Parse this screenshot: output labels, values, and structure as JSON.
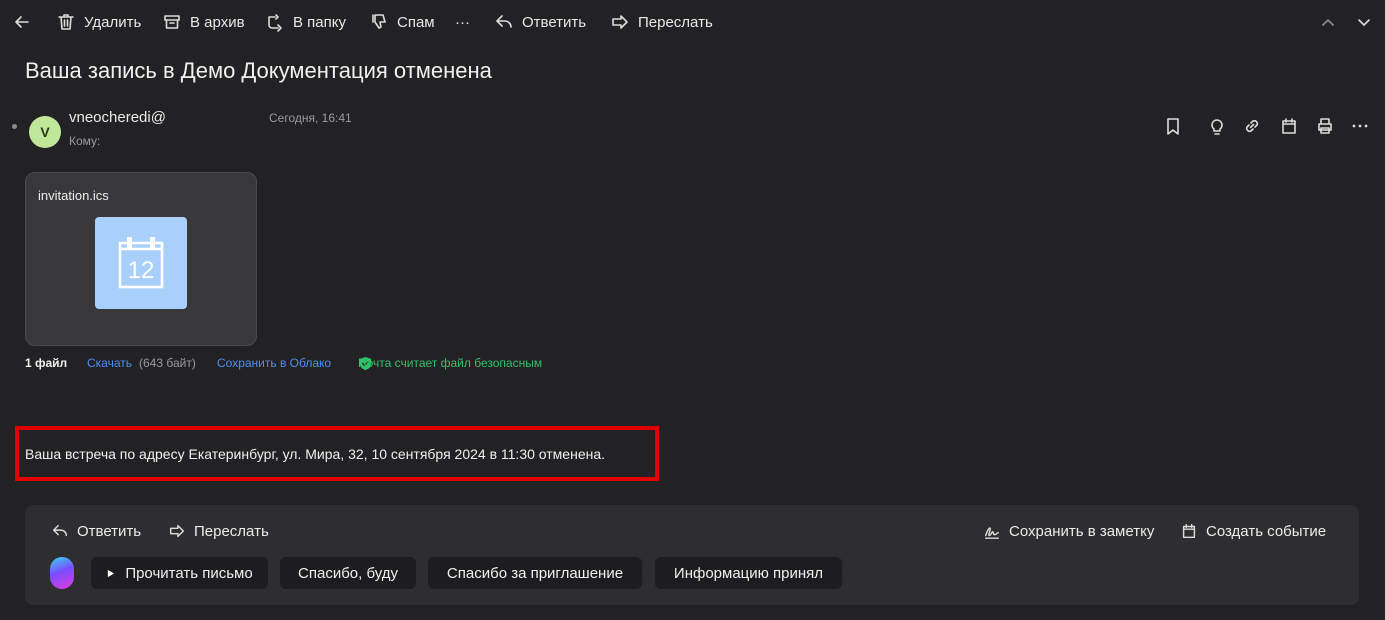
{
  "toolbar": {
    "back_icon": "arrow-left-icon",
    "delete_label": "Удалить",
    "archive_label": "В архив",
    "folder_label": "В папку",
    "spam_label": "Спам",
    "more_label": "···",
    "reply_label": "Ответить",
    "forward_label": "Переслать"
  },
  "subject": "Ваша запись в Демо Документация отменена",
  "message": {
    "avatar_letter": "V",
    "avatar_color": "#bfe89b",
    "sender": "vneocheredi@",
    "to_label": "Кому:",
    "date": "Сегодня, 16:41"
  },
  "attachment": {
    "file_name": "invitation.ics",
    "thumb_number": "12",
    "thumb_color": "#a9d0fb",
    "files_count": "1 файл",
    "download_label": "Скачать",
    "size": "(643 байт)",
    "save_cloud_label": "Сохранить в Облако",
    "safe_label": "Почта считает файл безопасным"
  },
  "body": {
    "text": "Ваша встреча по адресу Екатеринбург, ул. Мира, 32, 10 сентября 2024 в 11:30 отменена.",
    "highlight_color": "#e00000"
  },
  "panel": {
    "reply_label": "Ответить",
    "forward_label": "Переслать",
    "save_note_label": "Сохранить в заметку",
    "create_event_label": "Создать событие",
    "chips": [
      "Прочитать письмо",
      "Спасибо, буду",
      "Спасибо за приглашение",
      "Информацию принял"
    ]
  },
  "colors": {
    "background": "#222224",
    "link": "#4d8ef7",
    "safe": "#30c26a"
  }
}
